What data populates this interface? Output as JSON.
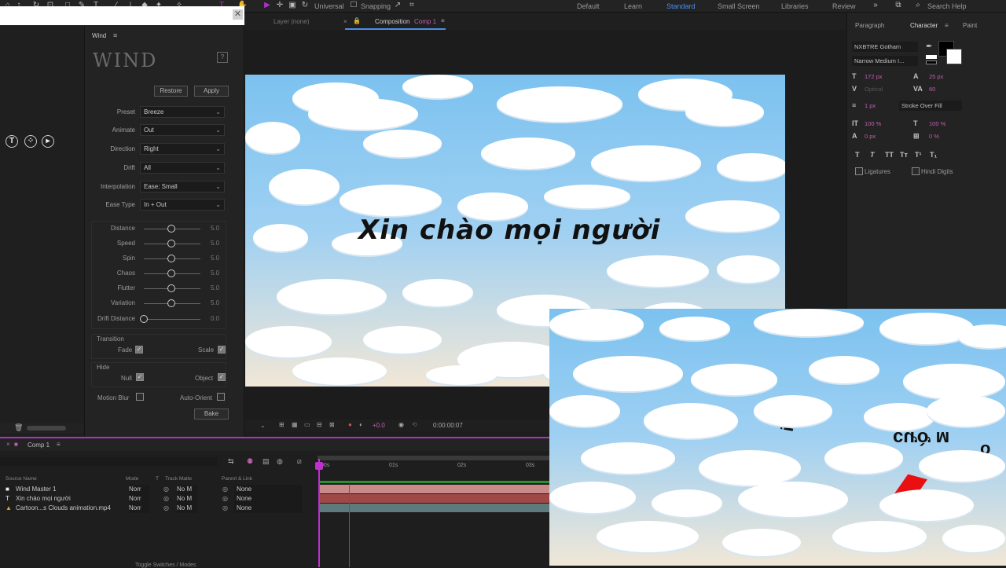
{
  "toolbar": {
    "snap_universal": "Universal",
    "snapping": "Snapping",
    "workspaces": [
      "Default",
      "Learn",
      "Standard",
      "Small Screen",
      "Libraries",
      "Review"
    ],
    "active_workspace": "Standard",
    "search_help": "Search Help"
  },
  "wind_panel": {
    "title": "Wind",
    "logo": "WIND",
    "help": "?",
    "restore": "Restore",
    "apply": "Apply",
    "dropdowns": [
      {
        "label": "Preset",
        "value": "Breeze"
      },
      {
        "label": "Animate",
        "value": "Out"
      },
      {
        "label": "Direction",
        "value": "Right"
      },
      {
        "label": "Drift",
        "value": "All"
      },
      {
        "label": "Interpolation",
        "value": "Ease: Small"
      },
      {
        "label": "Ease Type",
        "value": "In + Out"
      }
    ],
    "sliders": [
      {
        "label": "Distance",
        "value": "5.0",
        "level": 0.5
      },
      {
        "label": "Speed",
        "value": "5.0",
        "level": 0.5
      },
      {
        "label": "Spin",
        "value": "5.0",
        "level": 0.5
      },
      {
        "label": "Chaos",
        "value": "5.0",
        "level": 0.5
      },
      {
        "label": "Flutter",
        "value": "5.0",
        "level": 0.5
      },
      {
        "label": "Variation",
        "value": "5.0",
        "level": 0.5
      },
      {
        "label": "Drift Distance",
        "value": "0.0",
        "level": 0.0
      }
    ],
    "transition_label": "Transition",
    "fade": "Fade",
    "scale": "Scale",
    "hide_label": "Hide",
    "null": "Null",
    "object": "Object",
    "motion_blur": "Motion Blur",
    "auto_orient": "Auto-Orient",
    "bake": "Bake"
  },
  "comp": {
    "layer_tab": "Layer (none)",
    "comp_tab": "Composition",
    "comp_name": "Comp 1",
    "main_text": "Xin chào mọi người",
    "timecode": "0:00:00:07",
    "exposure": "+0.0"
  },
  "character": {
    "tab_paragraph": "Paragraph",
    "tab_character": "Character",
    "tab_paint": "Paint",
    "font": "NXBTRE Gotham",
    "style": "Narrow Medium I...",
    "size": "172 px",
    "leading": "25 px",
    "kerning": "Optical",
    "tracking": "60",
    "stroke": "1 px",
    "stroke_type": "Stroke Over Fill",
    "vscale": "100 %",
    "hscale": "100 %",
    "baseline": "0 px",
    "tsume": "0 %",
    "ligatures": "Ligatures",
    "hindi": "Hindi Digits",
    "styles": [
      "T",
      "T",
      "TT",
      "Tт",
      "T¹",
      "T₁"
    ]
  },
  "timeline": {
    "comp_tab": "Comp 1",
    "columns": [
      "Source Name",
      "Mode",
      "T",
      "Track Matte",
      "Parent & Link"
    ],
    "layers": [
      {
        "name": "Wind Master 1",
        "mode": "Norr",
        "matte": "No M",
        "parent": "None",
        "color": "#c98a8a"
      },
      {
        "name": "Xin chào mọi người",
        "mode": "Norr",
        "matte": "No M",
        "parent": "None",
        "color": "#a04848"
      },
      {
        "name": "Cartoon...s Clouds animation.mp4",
        "mode": "Norr",
        "matte": "No M",
        "parent": "None",
        "color": "#5f7a7c"
      }
    ],
    "ticks": [
      "00s",
      "01s",
      "02s",
      "03s"
    ],
    "footer": "Toggle Switches / Modes"
  }
}
